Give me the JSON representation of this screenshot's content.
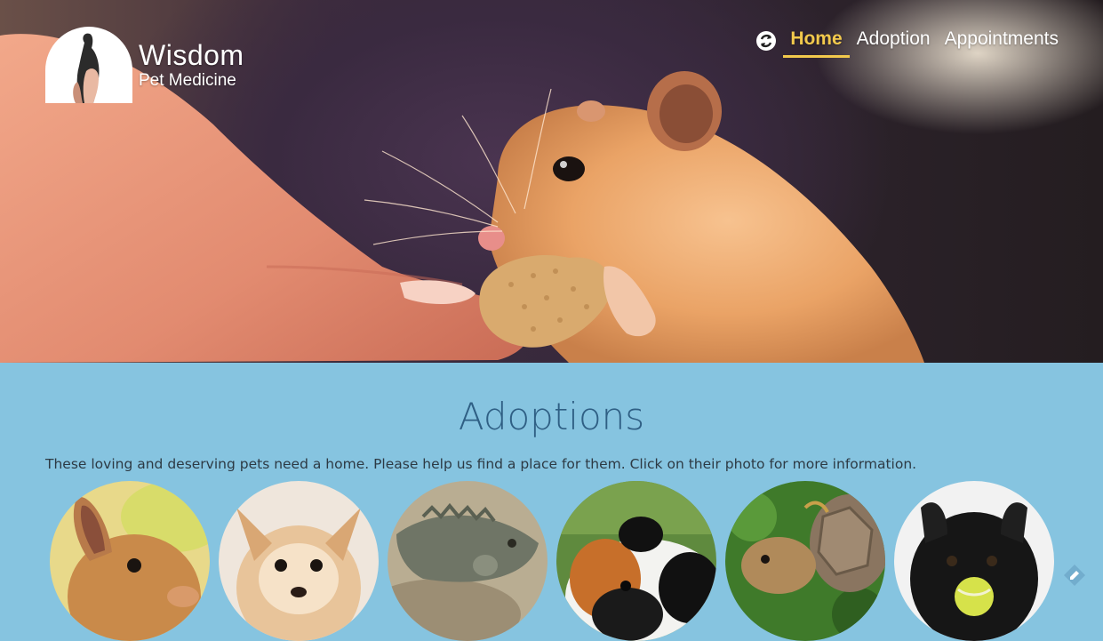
{
  "brand": {
    "name": "Wisdom",
    "subtitle": "Pet Medicine"
  },
  "nav": {
    "items": [
      {
        "label": "Home",
        "active": true
      },
      {
        "label": "Adoption",
        "active": false
      },
      {
        "label": "Appointments",
        "active": false
      }
    ],
    "accent_color": "#f2c94c"
  },
  "adoptions": {
    "title": "Adoptions",
    "description": "These loving and deserving pets need a home. Please help us find a place for them. Click on their photo for more information.",
    "pets": [
      "rabbit",
      "chihuahua",
      "iguana",
      "guinea-pig",
      "tortoise",
      "black-dog"
    ]
  },
  "colors": {
    "section_bg": "#86c4e0",
    "title": "#2f5f84"
  }
}
